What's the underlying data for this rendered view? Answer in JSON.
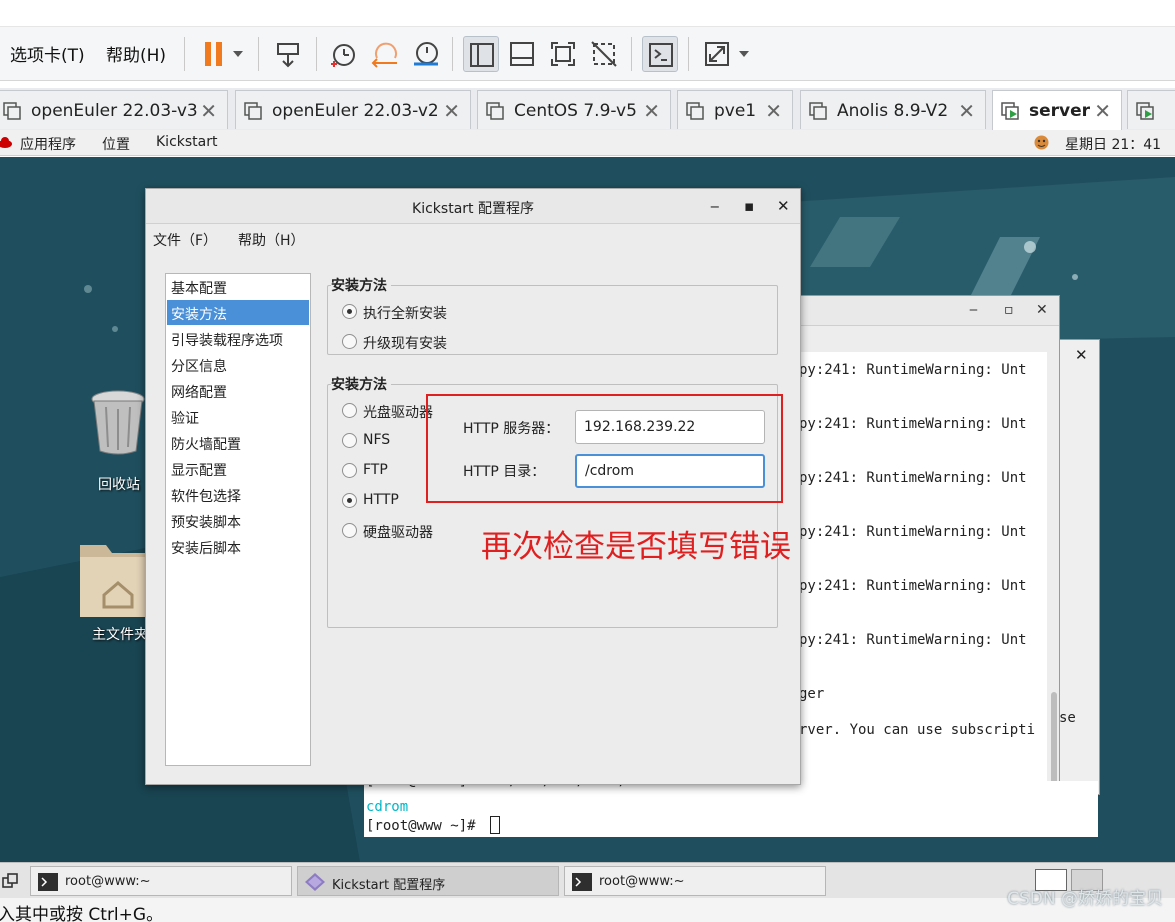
{
  "toolbar": {
    "tabs_menu": "选项卡(T)",
    "help_menu": "帮助(H)"
  },
  "vm_tabs": [
    {
      "label": "openEuler 22.03-v3",
      "active": false
    },
    {
      "label": "openEuler 22.03-v2",
      "active": false
    },
    {
      "label": "CentOS 7.9-v5",
      "active": false
    },
    {
      "label": "pve1",
      "active": false
    },
    {
      "label": "Anolis 8.9-V2",
      "active": false
    },
    {
      "label": "server",
      "active": true
    }
  ],
  "guest_panel": {
    "applications": "应用程序",
    "places": "位置",
    "app_name": "Kickstart",
    "clock": "星期日 21：41"
  },
  "desktop": {
    "trash_label": "回收站",
    "home_label": "主文件夹"
  },
  "terminal": {
    "lines": [
      "py:241: RuntimeWarning: Unt",
      "py:241: RuntimeWarning: Unt",
      "py:241: RuntimeWarning: Unt",
      "py:241: RuntimeWarning: Unt",
      "py:241: RuntimeWarning: Unt",
      "py:241: RuntimeWarning: Unt",
      "ger",
      "rver. You can use subscripti"
    ],
    "side_fragment": "se",
    "front_line_1": "[root@www ~]# ls /var/www/html/",
    "front_line_2": "cdrom",
    "front_prompt": "[root@www ~]# "
  },
  "kickstart": {
    "title": "Kickstart 配置程序",
    "menu_file": "文件（F）",
    "menu_help": "帮助（H）",
    "nav": [
      "基本配置",
      "安装方法",
      "引导装载程序选项",
      "分区信息",
      "网络配置",
      "验证",
      "防火墙配置",
      "显示配置",
      "软件包选择",
      "预安装脚本",
      "安装后脚本"
    ],
    "nav_selected_index": 1,
    "install_type": {
      "title": "安装方法",
      "options": [
        "执行全新安装",
        "升级现有安装"
      ],
      "selected_index": 0
    },
    "install_source": {
      "title": "安装方法",
      "options": [
        "光盘驱动器",
        "NFS",
        "FTP",
        "HTTP",
        "硬盘驱动器"
      ],
      "selected_index": 3
    },
    "http_server_label": "HTTP 服务器：",
    "http_server_value": "192.168.239.22",
    "http_dir_label": "HTTP 目录：",
    "http_dir_value": "/cdrom"
  },
  "annotation": "再次检查是否填写错误",
  "taskbar": [
    {
      "label": "root@www:~",
      "active": false
    },
    {
      "label": "Kickstart 配置程序",
      "active": true
    },
    {
      "label": "root@www:~",
      "active": false
    }
  ],
  "status_text": "入其中或按 Ctrl+G。",
  "watermark": "CSDN @娇娇的宝贝",
  "colors": {
    "annotation_red": "#e02020",
    "selection_blue": "#4a90d9",
    "pause_orange": "#f07a1d",
    "terminal_cyan": "#00b7c8"
  }
}
